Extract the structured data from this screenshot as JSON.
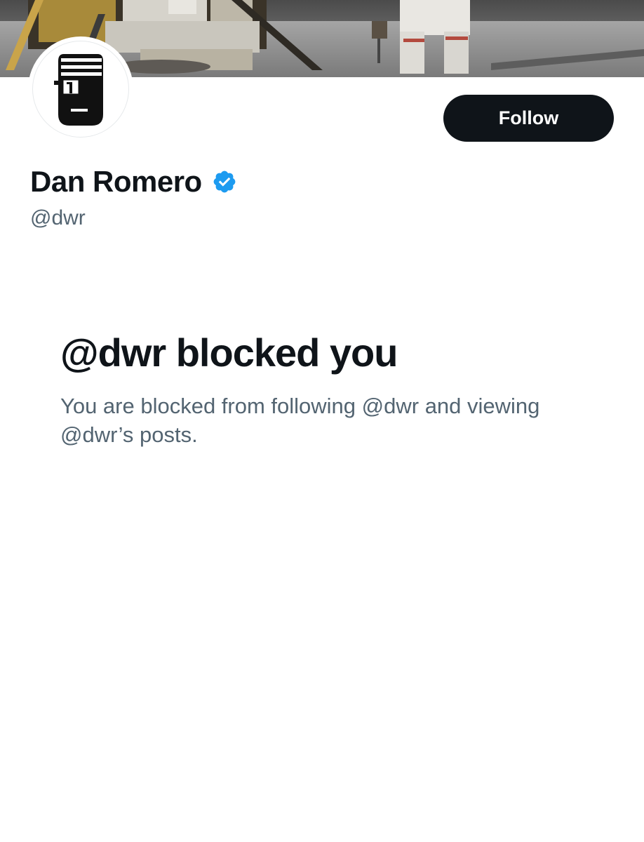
{
  "banner": {
    "description_icon": "moon-landing-photo"
  },
  "profile": {
    "display_name": "Dan Romero",
    "handle": "@dwr",
    "verified": true,
    "avatar_icon": "bandaged-face-avatar"
  },
  "actions": {
    "follow_label": "Follow"
  },
  "blocked": {
    "title": "@dwr blocked you",
    "description": "You are blocked from following @dwr and viewing @dwr’s posts."
  },
  "colors": {
    "primary_text": "#0f1419",
    "secondary_text": "#536471",
    "verified_blue": "#1d9bf0",
    "button_bg": "#0f1419"
  }
}
